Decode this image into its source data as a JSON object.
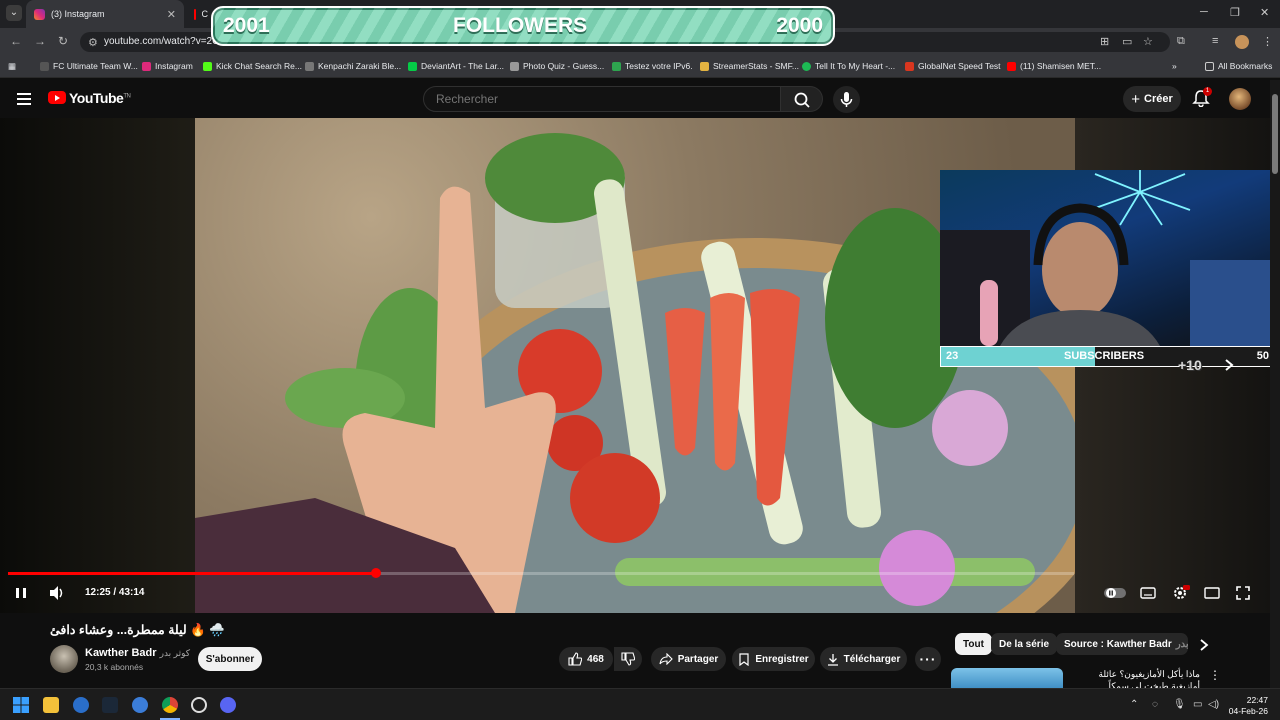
{
  "browser": {
    "tabs": [
      {
        "label": "(3) Instagram",
        "active": true
      },
      {
        "label": "C",
        "active": false
      }
    ],
    "url": "youtube.com/watch?v=2Co",
    "bookmarks": [
      "FC Ultimate Team W...",
      "Instagram",
      "Kick Chat Search Re...",
      "Kenpachi Zaraki Ble...",
      "DeviantArt - The Lar...",
      "Photo Quiz - Guess...",
      "Testez votre IPv6.",
      "StreamerStats - SMF...",
      "Tell It To My Heart -...",
      "GlobalNet Speed Test",
      "(11) Shamisen MET..."
    ],
    "all_bookmarks": "All Bookmarks"
  },
  "youtube": {
    "logo_text": "YouTube",
    "logo_sup": "TN",
    "search_placeholder": "Rechercher",
    "create_label": "Créer",
    "notif_count": "1"
  },
  "player": {
    "time_display": "12:25 / 43:14",
    "progress_fraction": 0.3451
  },
  "overlay": {
    "followers_left": "2001",
    "followers_label": "FOLLOWERS",
    "followers_right": "2000",
    "subs_current": "23",
    "subs_label": "SUBSCRIBERS",
    "subs_goal": "50",
    "subs_fill_fraction": 0.46,
    "subs_gain": "+10"
  },
  "video_info": {
    "title": "🌧️ 🔥 ليلة ممطرة... وعشاء دافئ",
    "channel_name": "Kawther Badr",
    "channel_name_ar": "كوثر بدر",
    "subscribers": "20,3 k abonnés",
    "subscribe_label": "S'abonner",
    "likes": "468",
    "share_label": "Partager",
    "save_label": "Enregistrer",
    "download_label": "Télécharger"
  },
  "sidebar": {
    "chips": [
      "Tout",
      "De la série",
      "Source : Kawther Badr"
    ],
    "chip_suffix": "كوثر بدر",
    "rec_title": "ماذا يأكل الأمازيغيون؟ عائلة أمازيغية طبخت لي سمكاً..."
  },
  "taskbar": {
    "time": "22:47",
    "date": "04-Feb-26"
  },
  "colors": {
    "yt_red": "#ff0000",
    "followers_bg": "#7fd8b7",
    "subs_fill": "#6ed2d2"
  }
}
